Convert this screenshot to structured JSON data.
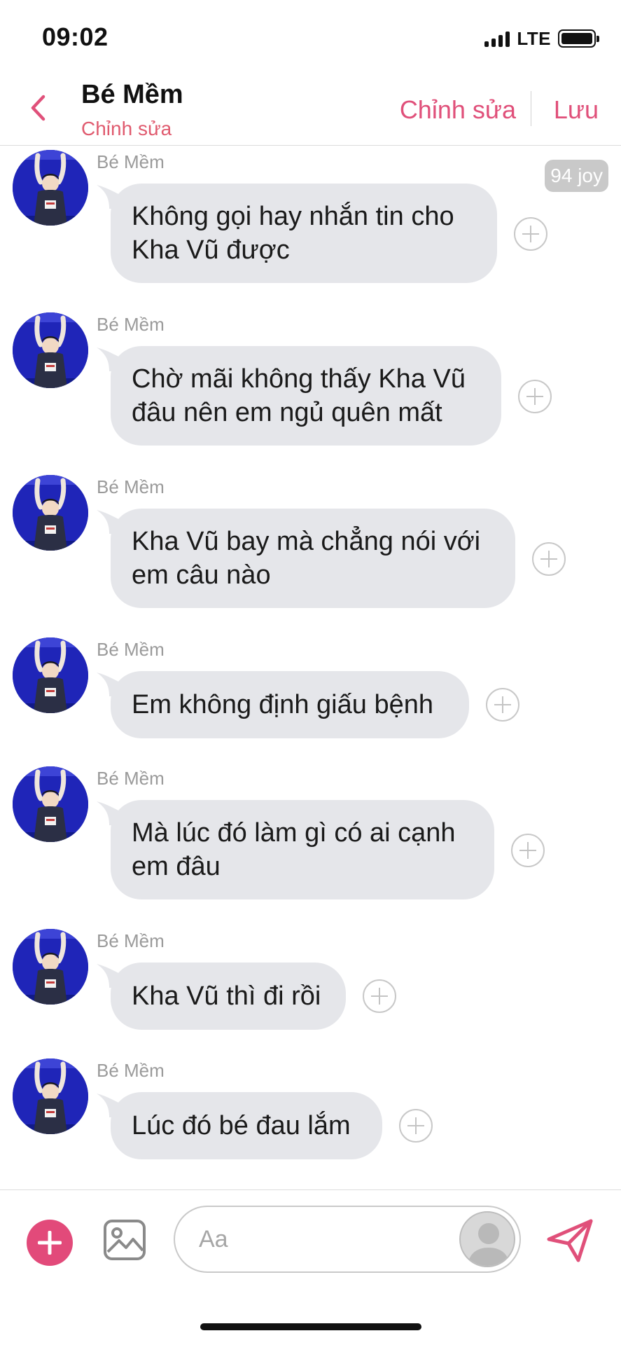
{
  "status_bar": {
    "time": "09:02",
    "network": "LTE"
  },
  "header": {
    "title": "Bé Mềm",
    "subtitle": "Chỉnh sửa",
    "edit_label": "Chỉnh sửa",
    "save_label": "Lưu"
  },
  "watermark": "94 joy",
  "messages": [
    {
      "sender": "Bé Mềm",
      "lines": [
        "Không gọi hay nhắn tin cho",
        "Kha Vũ được"
      ]
    },
    {
      "sender": "Bé Mềm",
      "lines": [
        "Chờ mãi không thấy Kha Vũ",
        "đâu nên em ngủ quên mất"
      ]
    },
    {
      "sender": "Bé Mềm",
      "lines": [
        "Kha Vũ bay mà chẳng nói với",
        "em câu nào"
      ]
    },
    {
      "sender": "Bé Mềm",
      "lines": [
        "Em không định giấu bệnh"
      ]
    },
    {
      "sender": "Bé Mềm",
      "lines": [
        "Mà lúc đó làm gì có ai cạnh",
        "em đâu"
      ]
    },
    {
      "sender": "Bé Mềm",
      "lines": [
        "Kha Vũ thì đi rồi"
      ]
    },
    {
      "sender": "Bé Mềm",
      "lines": [
        "Lúc đó bé đau lắm"
      ]
    }
  ],
  "composer": {
    "placeholder": "Aa"
  },
  "colors": {
    "accent": "#e24a7a",
    "bubble": "#e5e6ea",
    "subtitle": "#e05b6f"
  },
  "icons": [
    "back-chevron-icon",
    "plus-icon",
    "image-icon",
    "send-icon",
    "add-reaction-icon",
    "avatar-icon"
  ]
}
